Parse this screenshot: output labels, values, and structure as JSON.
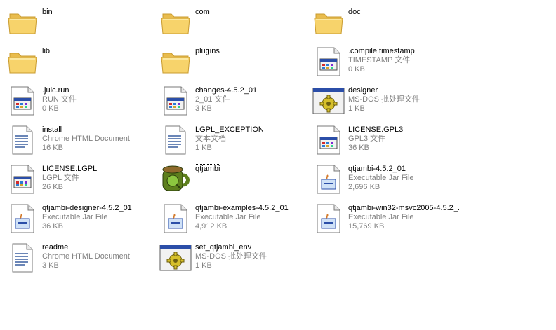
{
  "colors": {
    "folder": "#f7d36b",
    "type_text": "#808080",
    "name_text": "#000000"
  },
  "files": [
    {
      "name": "bin",
      "type": "",
      "size": "",
      "icon": "folder-icon"
    },
    {
      "name": "com",
      "type": "",
      "size": "",
      "icon": "folder-icon"
    },
    {
      "name": "doc",
      "type": "",
      "size": "",
      "icon": "folder-icon"
    },
    {
      "name": "lib",
      "type": "",
      "size": "",
      "icon": "folder-icon"
    },
    {
      "name": "plugins",
      "type": "",
      "size": "",
      "icon": "folder-icon"
    },
    {
      "name": ".compile.timestamp",
      "type": "TIMESTAMP 文件",
      "size": "0 KB",
      "icon": "generic-file-icon"
    },
    {
      "name": ".juic.run",
      "type": "RUN 文件",
      "size": "0 KB",
      "icon": "generic-file-icon"
    },
    {
      "name": "changes-4.5.2_01",
      "type": "2_01 文件",
      "size": "3 KB",
      "icon": "generic-file-icon"
    },
    {
      "name": "designer",
      "type": "MS-DOS 批处理文件",
      "size": "1 KB",
      "icon": "batch-file-icon"
    },
    {
      "name": "install",
      "type": "Chrome HTML Document",
      "size": "16 KB",
      "icon": "text-document-icon"
    },
    {
      "name": "LGPL_EXCEPTION",
      "type": "文本文档",
      "size": "1 KB",
      "icon": "text-document-icon"
    },
    {
      "name": "LICENSE.GPL3",
      "type": "GPL3 文件",
      "size": "36 KB",
      "icon": "generic-file-icon"
    },
    {
      "name": "LICENSE.LGPL",
      "type": "LGPL 文件",
      "size": "26 KB",
      "icon": "generic-file-icon"
    },
    {
      "name": "qtjambi",
      "type": "",
      "size": "",
      "icon": "qtjambi-app-icon"
    },
    {
      "name": "qtjambi-4.5.2_01",
      "type": "Executable Jar File",
      "size": "2,696 KB",
      "icon": "jar-file-icon"
    },
    {
      "name": "qtjambi-designer-4.5.2_01",
      "type": "Executable Jar File",
      "size": "36 KB",
      "icon": "jar-file-icon"
    },
    {
      "name": "qtjambi-examples-4.5.2_01",
      "type": "Executable Jar File",
      "size": "4,912 KB",
      "icon": "jar-file-icon"
    },
    {
      "name": "qtjambi-win32-msvc2005-4.5.2_...",
      "type": "Executable Jar File",
      "size": "15,769 KB",
      "icon": "jar-file-icon"
    },
    {
      "name": "readme",
      "type": "Chrome HTML Document",
      "size": "3 KB",
      "icon": "text-document-icon"
    },
    {
      "name": "set_qtjambi_env",
      "type": "MS-DOS 批处理文件",
      "size": "1 KB",
      "icon": "batch-file-icon"
    }
  ]
}
